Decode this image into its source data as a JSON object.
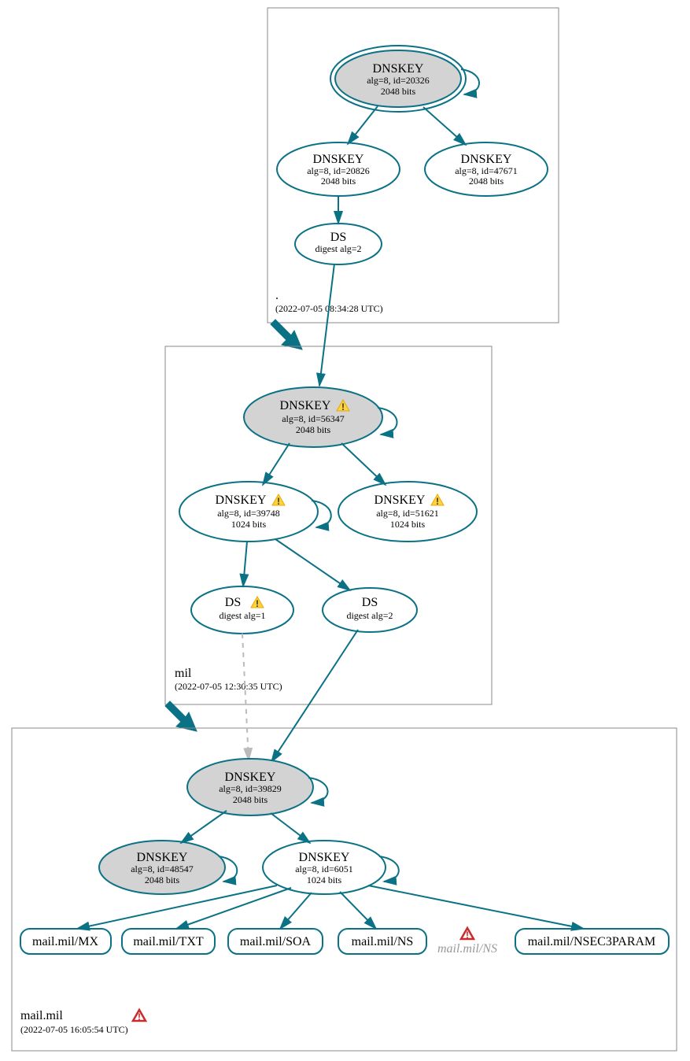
{
  "zones": {
    "root": {
      "name": ".",
      "timestamp": "(2022-07-05 08:34:28 UTC)"
    },
    "mil": {
      "name": "mil",
      "timestamp": "(2022-07-05 12:30:35 UTC)"
    },
    "mailmil": {
      "name": "mail.mil",
      "timestamp": "(2022-07-05 16:05:54 UTC)"
    }
  },
  "nodes": {
    "root_ksk": {
      "title": "DNSKEY",
      "l1": "alg=8, id=20326",
      "l2": "2048 bits"
    },
    "root_zsk1": {
      "title": "DNSKEY",
      "l1": "alg=8, id=20826",
      "l2": "2048 bits"
    },
    "root_zsk2": {
      "title": "DNSKEY",
      "l1": "alg=8, id=47671",
      "l2": "2048 bits"
    },
    "root_ds": {
      "title": "DS",
      "l1": "digest alg=2"
    },
    "mil_ksk": {
      "title": "DNSKEY",
      "l1": "alg=8, id=56347",
      "l2": "2048 bits"
    },
    "mil_zsk1": {
      "title": "DNSKEY",
      "l1": "alg=8, id=39748",
      "l2": "1024 bits"
    },
    "mil_zsk2": {
      "title": "DNSKEY",
      "l1": "alg=8, id=51621",
      "l2": "1024 bits"
    },
    "mil_ds1": {
      "title": "DS",
      "l1": "digest alg=1"
    },
    "mil_ds2": {
      "title": "DS",
      "l1": "digest alg=2"
    },
    "mm_ksk": {
      "title": "DNSKEY",
      "l1": "alg=8, id=39829",
      "l2": "2048 bits"
    },
    "mm_k2": {
      "title": "DNSKEY",
      "l1": "alg=8, id=48547",
      "l2": "2048 bits"
    },
    "mm_zsk": {
      "title": "DNSKEY",
      "l1": "alg=8, id=6051",
      "l2": "1024 bits"
    }
  },
  "rr": {
    "mx": "mail.mil/MX",
    "txt": "mail.mil/TXT",
    "soa": "mail.mil/SOA",
    "ns": "mail.mil/NS",
    "nserr": "mail.mil/NS",
    "nsec3": "mail.mil/NSEC3PARAM"
  }
}
